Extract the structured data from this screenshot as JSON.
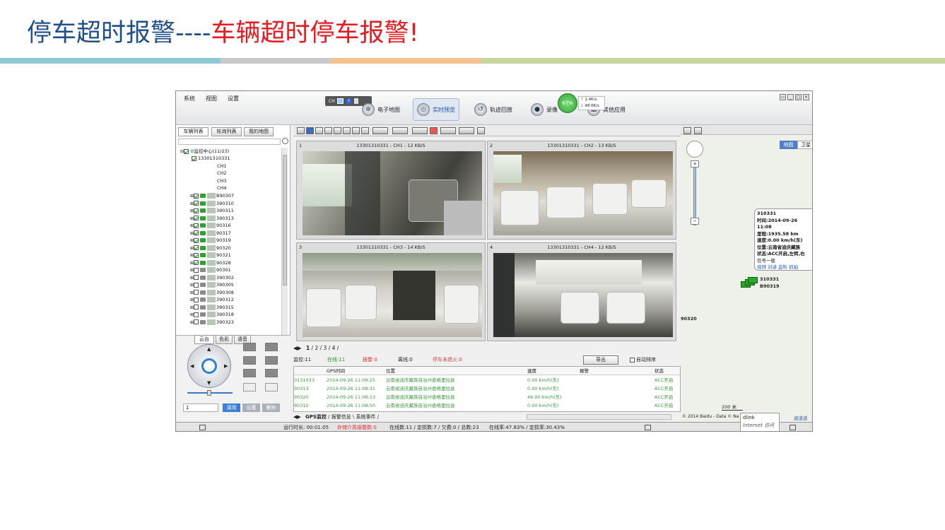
{
  "slide": {
    "title_part1": "停车超时报警----",
    "title_part2": "车辆超时停车报警!"
  },
  "colors": {
    "title_blue": "#1f4f8a",
    "title_red": "#e8191e",
    "bar_teal": "#8ecad6",
    "bar_grey": "#c9c9c9",
    "bar_orange": "#f7c08f",
    "bar_green": "#c6d6a0",
    "online_green": "#2ba62b"
  },
  "menu": [
    "系统",
    "视图",
    "设置"
  ],
  "mini_toolbar": {
    "label": "CH"
  },
  "nav": [
    {
      "label": "电子地图",
      "icon": "map-icon"
    },
    {
      "label": "实时预览",
      "icon": "preview-icon",
      "active": true
    },
    {
      "label": "轨迹回放",
      "icon": "track-icon"
    },
    {
      "label": "录像",
      "icon": "record-icon"
    },
    {
      "label": "其他应用",
      "icon": "apps-icon"
    }
  ],
  "network": {
    "percent": "67%",
    "up": "1.4K/s",
    "down": "48.6K/s"
  },
  "left_tabs": [
    "车辆列表",
    "轮询列表",
    "我的地图"
  ],
  "tree": {
    "root": "监控中心(11/23)",
    "vehicle": "13301310331",
    "channels": [
      "CH1",
      "CH2",
      "CH3",
      "CH4"
    ],
    "vehicles": [
      {
        "id": "B90307",
        "online": true
      },
      {
        "id": "390310",
        "online": true
      },
      {
        "id": "390311",
        "online": true
      },
      {
        "id": "390313",
        "online": true
      },
      {
        "id": "90316",
        "online": true
      },
      {
        "id": "90317",
        "online": true
      },
      {
        "id": "90319",
        "online": true
      },
      {
        "id": "90320",
        "online": true
      },
      {
        "id": "90321",
        "online": true
      },
      {
        "id": "90328",
        "online": true
      },
      {
        "id": "90301",
        "online": false
      },
      {
        "id": "390302",
        "online": false
      },
      {
        "id": "390305",
        "online": false
      },
      {
        "id": "390308",
        "online": false
      },
      {
        "id": "390312",
        "online": false
      },
      {
        "id": "390315",
        "online": false
      },
      {
        "id": "390318",
        "online": false
      },
      {
        "id": "390323",
        "online": false
      }
    ]
  },
  "ptz_tabs": [
    "云台",
    "色彩",
    "语音"
  ],
  "ptz": {
    "preset": "1",
    "call": "调用",
    "set": "设置",
    "delete": "删除"
  },
  "videos": [
    {
      "num": "1",
      "title": "13301310331 - CH1 - 12 KB/S"
    },
    {
      "num": "2",
      "title": "13301310331 - CH2 - 13 KB/S"
    },
    {
      "num": "3",
      "title": "13301310331 - CH3 - 14 KB/S"
    },
    {
      "num": "4",
      "title": "13301310331 - CH4 - 12 KB/S"
    }
  ],
  "pager": {
    "pages": [
      "1",
      "2",
      "3",
      "4"
    ]
  },
  "status": {
    "monitor": "监控:11",
    "online": "在线:11",
    "alarm": "报警:0",
    "offline": "离线:0",
    "parked": "停车未熄火:0",
    "export": "导出",
    "auto_sort": "自动排序"
  },
  "gps": {
    "headers": [
      "",
      "GPS时间",
      "位置",
      "速度",
      "报警",
      "状态"
    ],
    "rows": [
      {
        "id": "0131033",
        "time": "2014-09-26 11:08:25",
        "pos": "云南省迪庆藏族自治州香格里拉县",
        "speed": "0.00 km/h(东)",
        "alarm": "",
        "state": "ACC开启"
      },
      {
        "id": "90313",
        "time": "2014-09-26 11:08:31",
        "pos": "云南省迪庆藏族自治州香格里拉县",
        "speed": "0.00 km/h(东)",
        "alarm": "",
        "state": "ACC开启"
      },
      {
        "id": "90320",
        "time": "2014-09-26 11:08:13",
        "pos": "云南省迪庆藏族自治州香格里拉县",
        "speed": "46.00 km/h(东)",
        "alarm": "",
        "state": "ACC开启"
      },
      {
        "id": "90310",
        "time": "2014-09-26 11:08:50",
        "pos": "云南省迪庆藏族自治州香格里拉县",
        "speed": "0.00 km/h(东)",
        "alarm": "",
        "state": "ACC开启"
      }
    ]
  },
  "bottom_tabs": [
    "GPS监控",
    "报警信息",
    "系统事件"
  ],
  "footer": {
    "runtime": "运行时长: 00:01:05",
    "storage_alarm": "存储介质报警数:0",
    "stats": "在线数:11 / 定损数:7 / 欠费:0 / 总数:23",
    "rates": "在线率:47.83% / 定损率:30.43%",
    "dlink": "dlink",
    "internet": "Internet 访问"
  },
  "map": {
    "tab_map": "地图",
    "tab_sat": "卫星",
    "popup_title": "310331",
    "popup_lines": [
      "时间:2014-09-26 11:08",
      "里程:1935.58 km",
      "速度:0.00 km/h(东)",
      "位置:云南省迪庆藏族",
      "状态:ACC开启,左转,右",
      "信号一般"
    ],
    "popup_links": "视频 对讲 监听 抓拍",
    "marker_label1": "310331",
    "marker_label2": "B90319",
    "marker_label3": "90320",
    "scale": "200 米",
    "copyright": "© 2014 Baidu - Data © Na",
    "road": "道道道"
  }
}
